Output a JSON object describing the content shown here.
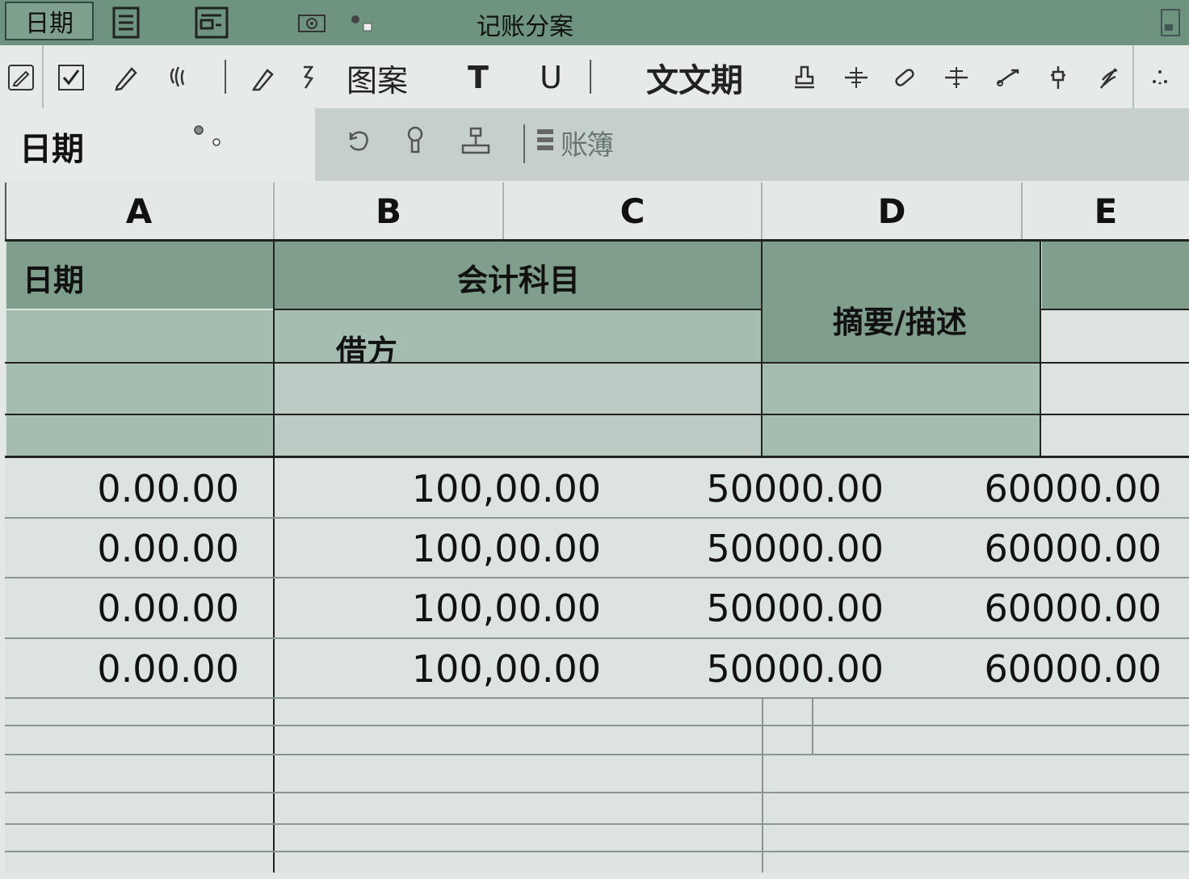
{
  "title_bar": {
    "tab_label": "日期",
    "app_title": "记账分案"
  },
  "toolbar": {
    "pattern_label": "图案",
    "t_label": "T",
    "u_label": "U",
    "text_label": "文文期"
  },
  "formula_bar": {
    "name_box": "日期",
    "content_text": "账簿"
  },
  "columns": [
    "A",
    "B",
    "C",
    "D",
    "E"
  ],
  "sheet_header": {
    "date": "日期",
    "account": "会计科目",
    "debit": "借方",
    "summary": "摘要/描述"
  },
  "rows": [
    {
      "a": "0.00.00",
      "b": "100,00.00",
      "c": "50000.00",
      "e": "60000.00"
    },
    {
      "a": "0.00.00",
      "b": "100,00.00",
      "c": "50000.00",
      "e": "60000.00"
    },
    {
      "a": "0.00.00",
      "b": "100,00.00",
      "c": "50000.00",
      "e": "60000.00"
    },
    {
      "a": "0.00.00",
      "b": "100,00.00",
      "c": "50000.00",
      "e": "60000.00"
    }
  ],
  "colors": {
    "title_bar": "#6e9480",
    "header_dark": "#7f9e8c",
    "header_mid": "#a5bcb0",
    "grid_bg": "#dde4e0"
  }
}
